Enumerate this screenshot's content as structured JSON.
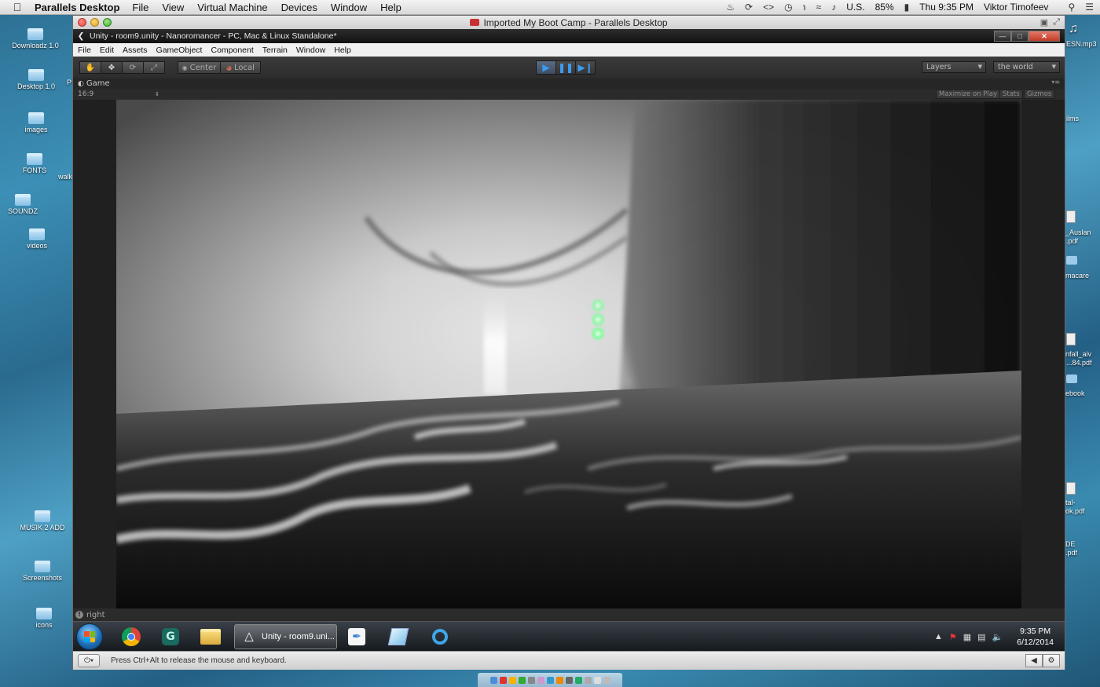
{
  "mac_menubar": {
    "app_name": "Parallels Desktop",
    "menus": [
      "File",
      "View",
      "Virtual Machine",
      "Devices",
      "Window",
      "Help"
    ],
    "input_source": "U.S.",
    "battery": "85%",
    "clock": "Thu 9:35 PM",
    "user": "Viktor Timofeev"
  },
  "desktop": {
    "left_icons": [
      "Downloadz 1.0",
      "Desktop 1.0",
      "images",
      "FONTS",
      "SOUNDZ",
      "videos",
      "MUSIK 2 ADD",
      "Screenshots",
      "icons"
    ],
    "left_fragments": [
      "walk",
      "P"
    ],
    "right_fragments": [
      "ESN.mp3",
      "ilms",
      "_Auslan",
      ".pdf",
      "macare",
      "nfall_aiv",
      "...84.pdf",
      "ebook",
      "tal-",
      "ok.pdf",
      "DE",
      ".pdf"
    ]
  },
  "parallels": {
    "window_title": "Imported My Boot Camp - Parallels Desktop",
    "status_message": "Press Ctrl+Alt to release the mouse and keyboard."
  },
  "unity": {
    "window_title": "Unity - room9.unity - Nanoromancer - PC, Mac & Linux Standalone*",
    "menu": [
      "File",
      "Edit",
      "Assets",
      "GameObject",
      "Component",
      "Terrain",
      "Window",
      "Help"
    ],
    "toolbar": {
      "pivot_label": "Center",
      "space_label": "Local",
      "layers_label": "Layers",
      "layout_label": "the world"
    },
    "game_tab_label": "Game",
    "aspect_label": "16:9",
    "game_buttons": [
      "Maximize on Play",
      "Stats",
      "Gizmos"
    ],
    "console_status": "right"
  },
  "taskbar": {
    "unity_task_label": "Unity - room9.uni...",
    "time": "9:35 PM",
    "date": "6/12/2014"
  },
  "colors": {
    "play_active": "#3c9cf0",
    "glow_green": "#7dff9a"
  }
}
